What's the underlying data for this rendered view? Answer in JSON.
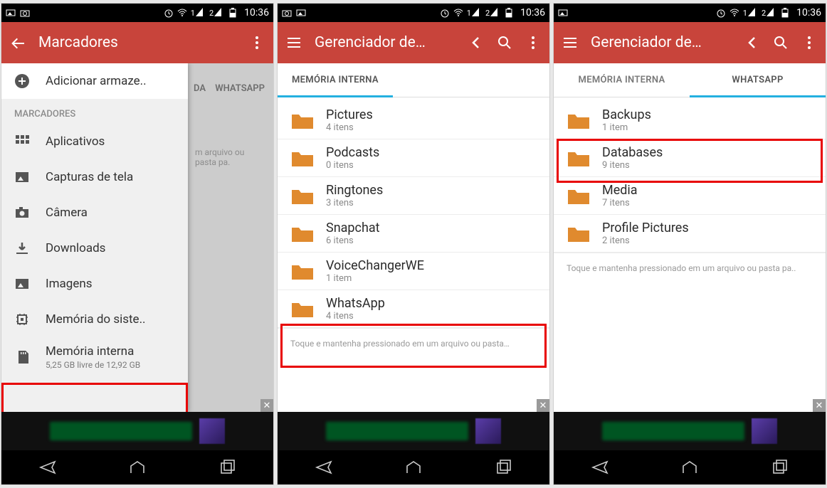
{
  "status": {
    "sim1": "1",
    "sim2": "2",
    "time": "10:36"
  },
  "phone1": {
    "app_title": "Marcadores",
    "drawer": {
      "add_storage": "Adicionar armaze..",
      "section": "MARCADORES",
      "items": [
        {
          "label": "Aplicativos"
        },
        {
          "label": "Capturas de tela"
        },
        {
          "label": "Câmera"
        },
        {
          "label": "Downloads"
        },
        {
          "label": "Imagens"
        },
        {
          "label": "Memória do siste.."
        },
        {
          "label": "Memória interna",
          "sub": "5,25 GB livre de 12,92 GB"
        }
      ]
    },
    "shadow_tab1": "DA",
    "shadow_tab2": "WHATSAPP",
    "shadow_hint": "m arquivo ou pasta pa."
  },
  "phone2": {
    "app_title": "Gerenciador de…",
    "tab_active": "MEMÓRIA INTERNA",
    "folders": [
      {
        "name": "Pictures",
        "meta": "4 itens"
      },
      {
        "name": "Podcasts",
        "meta": "0 itens"
      },
      {
        "name": "Ringtones",
        "meta": "3 itens"
      },
      {
        "name": "Snapchat",
        "meta": "6 itens"
      },
      {
        "name": "VoiceChangerWE",
        "meta": "1 item"
      },
      {
        "name": "WhatsApp",
        "meta": "4 itens"
      }
    ],
    "hint": "Toque e mantenha pressionado em um arquivo ou pasta…"
  },
  "phone3": {
    "app_title": "Gerenciador de…",
    "tab_inactive": "MEMÓRIA INTERNA",
    "tab_active": "WHATSAPP",
    "folders": [
      {
        "name": "Backups",
        "meta": "1 item"
      },
      {
        "name": "Databases",
        "meta": "9 itens"
      },
      {
        "name": "Media",
        "meta": "7 itens"
      },
      {
        "name": "Profile Pictures",
        "meta": "2 itens"
      }
    ],
    "hint": "Toque e mantenha pressionado em um arquivo ou pasta pa.."
  }
}
